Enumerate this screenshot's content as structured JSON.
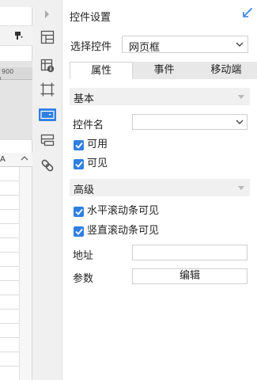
{
  "canvas": {
    "ruler_value": "900",
    "column_letter": "A"
  },
  "sidebar": {
    "icons": [
      {
        "name": "expand-arrow-icon"
      },
      {
        "name": "layout-icon"
      },
      {
        "name": "component-info-icon"
      },
      {
        "name": "crop-frame-icon"
      },
      {
        "name": "widget-settings-icon",
        "selected": true
      },
      {
        "name": "form-list-icon"
      },
      {
        "name": "link-icon"
      }
    ],
    "accent": "#2f7fe0"
  },
  "panel": {
    "title": "控件设置",
    "select_label": "选择控件",
    "select_value": "网页框",
    "tabs": [
      "属性",
      "事件",
      "移动端"
    ],
    "active_tab": 0,
    "basic": {
      "section_title": "基本",
      "name_label": "控件名",
      "name_value": "",
      "checkboxes": [
        {
          "label": "可用",
          "checked": true
        },
        {
          "label": "可见",
          "checked": true
        }
      ]
    },
    "advanced": {
      "section_title": "高级",
      "checkboxes": [
        {
          "label": "水平滚动条可见",
          "checked": true
        },
        {
          "label": "竖直滚动条可见",
          "checked": true
        }
      ],
      "address_label": "地址",
      "address_value": "",
      "params_label": "参数",
      "params_button": "编辑"
    }
  }
}
